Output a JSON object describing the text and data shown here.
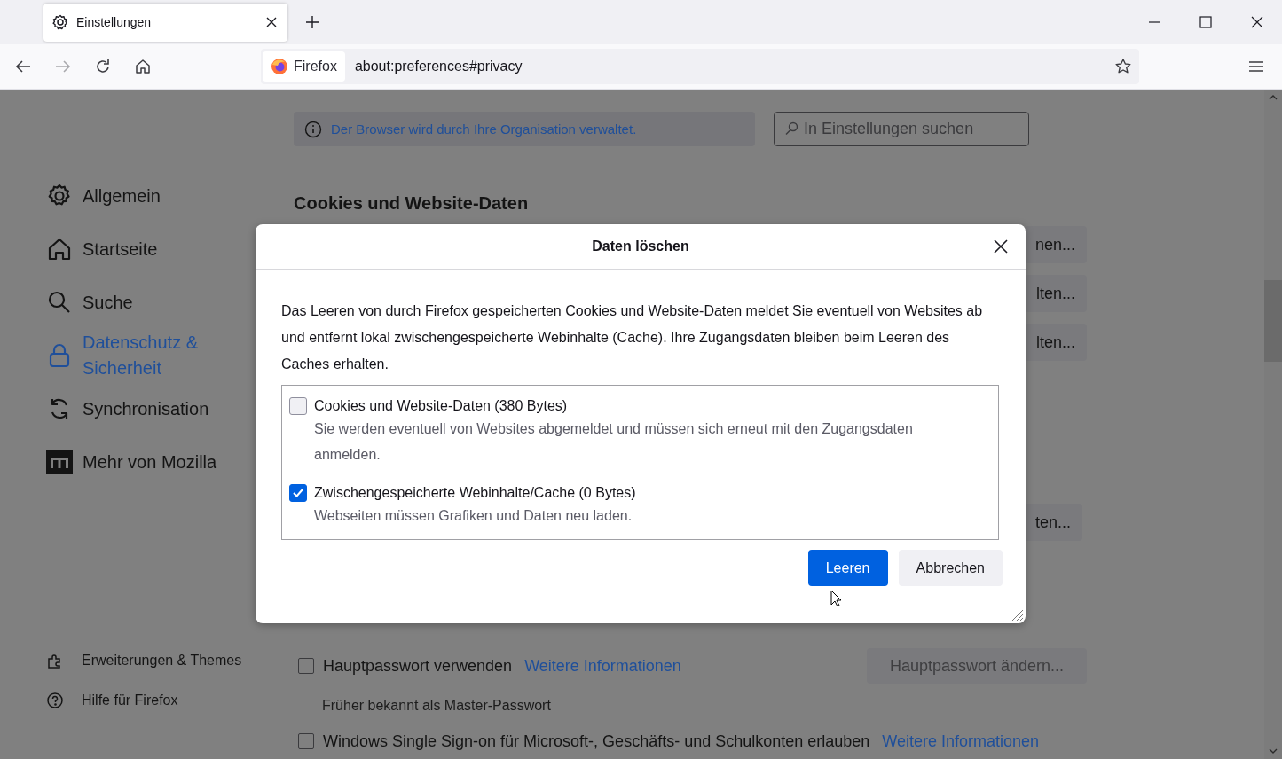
{
  "tabs": [
    {
      "label": "Einstellungen",
      "selected": true
    }
  ],
  "toolbar": {
    "identity": "Firefox",
    "url": "about:preferences#privacy"
  },
  "sidebar": {
    "items": [
      {
        "label": "Allgemein",
        "selected": false
      },
      {
        "label": "Startseite",
        "selected": false
      },
      {
        "label": "Suche",
        "selected": false
      },
      {
        "label": "Datenschutz & Sicherheit",
        "selected": true
      },
      {
        "label": "Synchronisation",
        "selected": false
      },
      {
        "label": "Mehr von Mozilla",
        "selected": false
      }
    ],
    "footer": [
      {
        "label": "Erweiterungen & Themes"
      },
      {
        "label": "Hilfe für Firefox"
      }
    ]
  },
  "notice": "Der Browser wird durch Ihre Organisation verwaltet.",
  "search": {
    "placeholder": "In Einstellungen suchen"
  },
  "section_title": "Cookies und Website-Daten",
  "side_buttons": [
    "nen...",
    "lten...",
    "lten...",
    "ten..."
  ],
  "rows": [
    {
      "kind": "checkbox",
      "label": "Hauptpasswort verwenden",
      "checked": false,
      "link": "Weitere Informationen",
      "button": "Hauptpasswort ändern...",
      "button_disabled": true
    },
    {
      "kind": "note",
      "text": "Früher bekannt als Master-Passwort"
    },
    {
      "kind": "checkbox",
      "label": "Windows Single Sign-on für Microsoft-, Geschäfts- und Schulkonten erlauben",
      "checked": false,
      "link": "Weitere Informationen"
    }
  ],
  "dialog": {
    "title": "Daten löschen",
    "description": "Das Leeren von durch Firefox gespeicherten Cookies und Website-Daten meldet Sie eventuell von Websites ab und entfernt lokal zwischengespeicherte Webinhalte (Cache). Ihre Zugangsdaten bleiben beim Leeren des Caches erhalten.",
    "options": [
      {
        "label": "Cookies und Website-Daten (380 Bytes)",
        "detail": "Sie werden eventuell von Websites abgemeldet und müssen sich erneut mit den Zugangsdaten anmelden.",
        "checked": false
      },
      {
        "label": "Zwischengespeicherte Webinhalte/Cache (0 Bytes)",
        "detail": "Webseiten müssen Grafiken und Daten neu laden.",
        "checked": true
      }
    ],
    "buttons": [
      {
        "label": "Leeren",
        "kind": "primary"
      },
      {
        "label": "Abbrechen",
        "kind": "secondary"
      }
    ]
  }
}
